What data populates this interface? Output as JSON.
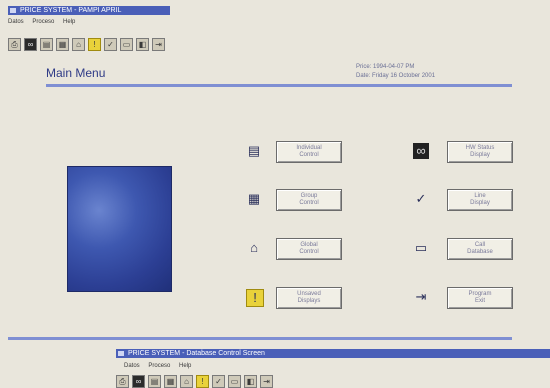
{
  "window": {
    "title": "PRICE SYSTEM - PAMPI APRIL",
    "menu": [
      "Datos",
      "Proceso",
      "Help"
    ]
  },
  "toolbar": {
    "icons": [
      "printer-icon",
      "binoculars-icon",
      "form-icon",
      "boxes-icon",
      "house-icon",
      "warning-icon",
      "checkmark-icon",
      "window-icon",
      "gauge-icon",
      "exit-icon"
    ]
  },
  "header": {
    "title": "Main Menu",
    "info_line1": "Price: 1994-04-07   PM",
    "info_line2": "Date: Friday 16  October  2001"
  },
  "menu_buttons": [
    {
      "icon": "form-icon",
      "label": "Individual\nControl"
    },
    {
      "icon": "boxes-icon",
      "label": "Group\nControl"
    },
    {
      "icon": "house-icon",
      "label": "Global\nControl"
    },
    {
      "icon": "warning-icon",
      "label": "Unsaved\nDisplays"
    },
    {
      "icon": "binoculars-icon",
      "label": "HW Status\nDisplay"
    },
    {
      "icon": "checkmark-icon",
      "label": "Line\nDisplay"
    },
    {
      "icon": "window-icon",
      "label": "Call\nDatabase"
    },
    {
      "icon": "exit-icon",
      "label": "Program\nExit"
    }
  ],
  "second_window": {
    "title": "PRICE SYSTEM - Database Control Screen",
    "menu": [
      "Datos",
      "Proceso",
      "Help"
    ]
  }
}
